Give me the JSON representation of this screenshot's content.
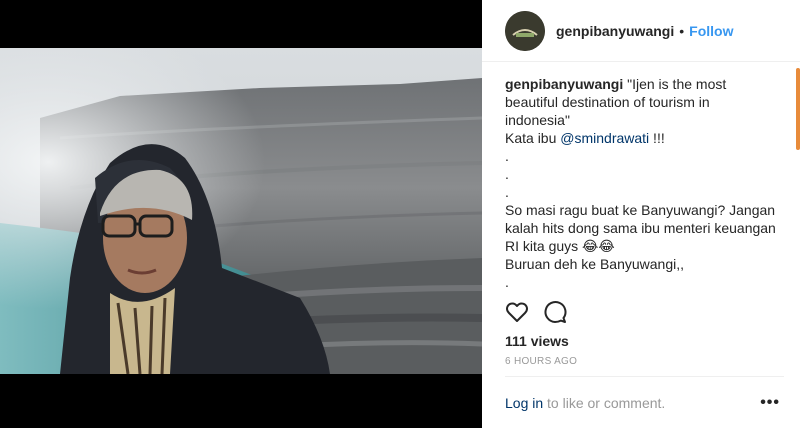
{
  "post": {
    "username": "genpibanyuwangi",
    "follow_label": "Follow",
    "header_separator": "•"
  },
  "caption": {
    "lines": [
      "\"Ijen is the most",
      "beautiful destination of tourism in",
      "indonesia\"",
      "Kata ibu ",
      ".",
      ".",
      ".",
      "So masi ragu buat ke Banyuwangi? Jangan",
      "kalah hits dong sama ibu menteri keuangan",
      "RI kita guys 😂😂",
      "Buruan deh ke Banyuwangi,,",
      "."
    ],
    "mention": "@smindrawati",
    "mention_suffix": " !!!"
  },
  "stats": {
    "views": "111 views",
    "timestamp": "6 HOURS AGO"
  },
  "footer": {
    "login_link": "Log in",
    "login_rest": " to like or comment.",
    "more_label": "•••"
  },
  "icons": {
    "like": "heart-icon",
    "comment": "comment-icon",
    "more": "more-options-icon"
  },
  "colors": {
    "link_blue": "#3897f0",
    "mention_dark_blue": "#003569",
    "muted_gray": "#999999",
    "scroll_accent": "#e88b3a"
  }
}
